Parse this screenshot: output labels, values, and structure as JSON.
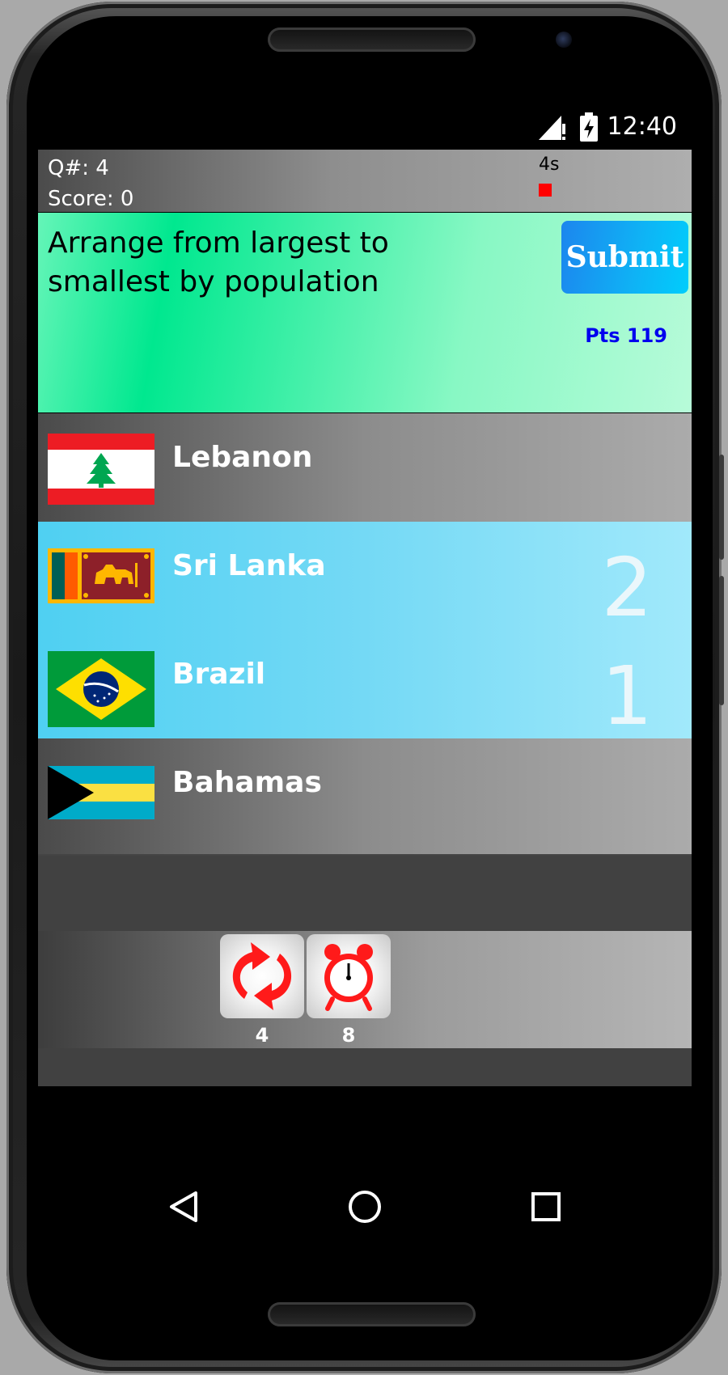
{
  "status_bar": {
    "time": "12:40",
    "icons": [
      "signal-icon",
      "battery-charging-icon"
    ]
  },
  "game": {
    "question_number_label": "Q#: 4",
    "score_label": "Score: 0",
    "timer_label": "4s",
    "question": "Arrange from largest to smallest by population",
    "submit_label": "Submit",
    "points_label": "Pts 119"
  },
  "countries": [
    {
      "name": "Lebanon",
      "flag": "lebanon-flag",
      "rank": ""
    },
    {
      "name": "Sri Lanka",
      "flag": "sri-lanka-flag",
      "rank": "2"
    },
    {
      "name": "Brazil",
      "flag": "brazil-flag",
      "rank": "1"
    },
    {
      "name": "Bahamas",
      "flag": "bahamas-flag",
      "rank": ""
    }
  ],
  "powerups": [
    {
      "icon": "refresh-arrows-icon",
      "count": "4"
    },
    {
      "icon": "alarm-clock-icon",
      "count": "8"
    }
  ],
  "nav": [
    "back-icon",
    "home-icon",
    "recents-icon"
  ],
  "colors": {
    "question_panel": "#00e88f",
    "selected_row": "#74d9f5",
    "submit": "#1c86ee",
    "points_text": "#0000ee",
    "timer_square": "#ff0000",
    "powerup_icon": "#ff1a1a"
  }
}
